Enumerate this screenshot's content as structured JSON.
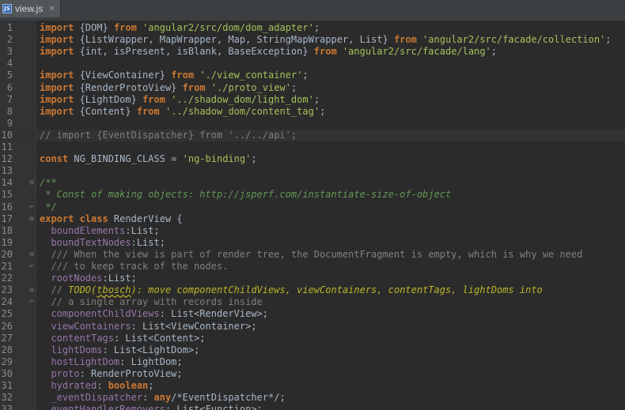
{
  "tab": {
    "label": "view.js",
    "icon": "js-file-icon",
    "icon_text": "JS"
  },
  "colors": {
    "background": "#2b2b2b",
    "keyword": "#cc7832",
    "string": "#a5c25c",
    "comment": "#808080",
    "doc_comment": "#629755",
    "property": "#9876aa",
    "todo": "#bbb529"
  },
  "lines": [
    {
      "n": "1",
      "tokens": [
        [
          "kw",
          "import"
        ],
        [
          "id",
          " {DOM} "
        ],
        [
          "kw",
          "from"
        ],
        [
          "id",
          " "
        ],
        [
          "str",
          "'angular2/src/dom/dom_adapter'"
        ],
        [
          "id",
          ";"
        ]
      ]
    },
    {
      "n": "2",
      "tokens": [
        [
          "kw",
          "import"
        ],
        [
          "id",
          " {ListWrapper, MapWrapper, Map, StringMapWrapper, List} "
        ],
        [
          "kw",
          "from"
        ],
        [
          "id",
          " "
        ],
        [
          "str",
          "'angular2/src/facade/collection'"
        ],
        [
          "id",
          ";"
        ]
      ]
    },
    {
      "n": "3",
      "tokens": [
        [
          "kw",
          "import"
        ],
        [
          "id",
          " {int, isPresent, isBlank, BaseException} "
        ],
        [
          "kw",
          "from"
        ],
        [
          "id",
          " "
        ],
        [
          "str",
          "'angular2/src/facade/lang'"
        ],
        [
          "id",
          ";"
        ]
      ]
    },
    {
      "n": "4",
      "tokens": []
    },
    {
      "n": "5",
      "tokens": [
        [
          "kw",
          "import"
        ],
        [
          "id",
          " {ViewContainer} "
        ],
        [
          "kw",
          "from"
        ],
        [
          "id",
          " "
        ],
        [
          "str",
          "'./view_container'"
        ],
        [
          "id",
          ";"
        ]
      ]
    },
    {
      "n": "6",
      "tokens": [
        [
          "kw",
          "import"
        ],
        [
          "id",
          " {RenderProtoView} "
        ],
        [
          "kw",
          "from"
        ],
        [
          "id",
          " "
        ],
        [
          "str",
          "'./proto_view'"
        ],
        [
          "id",
          ";"
        ]
      ]
    },
    {
      "n": "7",
      "tokens": [
        [
          "kw",
          "import"
        ],
        [
          "id",
          " {LightDom} "
        ],
        [
          "kw",
          "from"
        ],
        [
          "id",
          " "
        ],
        [
          "str",
          "'../shadow_dom/light_dom'"
        ],
        [
          "id",
          ";"
        ]
      ]
    },
    {
      "n": "8",
      "tokens": [
        [
          "kw",
          "import"
        ],
        [
          "id",
          " {Content} "
        ],
        [
          "kw",
          "from"
        ],
        [
          "id",
          " "
        ],
        [
          "str",
          "'../shadow_dom/content_tag'"
        ],
        [
          "id",
          ";"
        ]
      ]
    },
    {
      "n": "9",
      "tokens": []
    },
    {
      "n": "10",
      "highlight": true,
      "tokens": [
        [
          "com",
          "// import {EventDispatcher} from '../../api';"
        ]
      ]
    },
    {
      "n": "11",
      "tokens": []
    },
    {
      "n": "12",
      "tokens": [
        [
          "kw",
          "const"
        ],
        [
          "id",
          " NG_BINDING_CLASS = "
        ],
        [
          "str",
          "'ng-binding'"
        ],
        [
          "id",
          ";"
        ]
      ]
    },
    {
      "n": "13",
      "tokens": []
    },
    {
      "n": "14",
      "fold": "open",
      "tokens": [
        [
          "doc",
          "/**"
        ]
      ]
    },
    {
      "n": "15",
      "tokens": [
        [
          "doc",
          " * Const of making objects: http://jsperf.com/instantiate-size-of-object"
        ]
      ]
    },
    {
      "n": "16",
      "fold": "close",
      "tokens": [
        [
          "doc",
          " */"
        ]
      ]
    },
    {
      "n": "17",
      "fold": "open",
      "tokens": [
        [
          "kw",
          "export class"
        ],
        [
          "id",
          " RenderView {"
        ]
      ]
    },
    {
      "n": "18",
      "tokens": [
        [
          "id",
          "  "
        ],
        [
          "prop",
          "boundElements"
        ],
        [
          "id",
          ":List;"
        ]
      ]
    },
    {
      "n": "19",
      "tokens": [
        [
          "id",
          "  "
        ],
        [
          "prop",
          "boundTextNodes"
        ],
        [
          "id",
          ":List;"
        ]
      ]
    },
    {
      "n": "20",
      "fold": "open",
      "tokens": [
        [
          "com",
          "  /// When the view is part of render tree, the DocumentFragment is empty, which is why we need"
        ]
      ]
    },
    {
      "n": "21",
      "fold": "close",
      "tokens": [
        [
          "com",
          "  /// to keep track of the nodes."
        ]
      ]
    },
    {
      "n": "22",
      "tokens": [
        [
          "id",
          "  "
        ],
        [
          "prop",
          "rootNodes"
        ],
        [
          "id",
          ":List;"
        ]
      ]
    },
    {
      "n": "23",
      "fold": "open",
      "tokens": [
        [
          "com",
          "  // "
        ],
        [
          "todo",
          "TODO("
        ],
        [
          "ul",
          "tbosch"
        ],
        [
          "todo",
          "): move componentChildViews, viewContainers, contentTags, lightDoms into"
        ]
      ]
    },
    {
      "n": "24",
      "fold": "close",
      "tokens": [
        [
          "com",
          "  // a single array with records inside"
        ]
      ]
    },
    {
      "n": "25",
      "tokens": [
        [
          "id",
          "  "
        ],
        [
          "prop",
          "componentChildViews"
        ],
        [
          "id",
          ": List<RenderView>;"
        ]
      ]
    },
    {
      "n": "26",
      "tokens": [
        [
          "id",
          "  "
        ],
        [
          "prop",
          "viewContainers"
        ],
        [
          "id",
          ": List<ViewContainer>;"
        ]
      ]
    },
    {
      "n": "27",
      "tokens": [
        [
          "id",
          "  "
        ],
        [
          "prop",
          "contentTags"
        ],
        [
          "id",
          ": List<Content>;"
        ]
      ]
    },
    {
      "n": "28",
      "tokens": [
        [
          "id",
          "  "
        ],
        [
          "prop",
          "lightDoms"
        ],
        [
          "id",
          ": List<LightDom>;"
        ]
      ]
    },
    {
      "n": "29",
      "tokens": [
        [
          "id",
          "  "
        ],
        [
          "prop",
          "hostLightDom"
        ],
        [
          "id",
          ": LightDom;"
        ]
      ]
    },
    {
      "n": "30",
      "tokens": [
        [
          "id",
          "  "
        ],
        [
          "prop",
          "proto"
        ],
        [
          "id",
          ": RenderProtoView;"
        ]
      ]
    },
    {
      "n": "31",
      "tokens": [
        [
          "id",
          "  "
        ],
        [
          "prop",
          "hydrated"
        ],
        [
          "id",
          ": "
        ],
        [
          "kw",
          "boolean"
        ],
        [
          "id",
          ";"
        ]
      ]
    },
    {
      "n": "32",
      "tokens": [
        [
          "id",
          "  "
        ],
        [
          "prop",
          "_eventDispatcher"
        ],
        [
          "id",
          ": "
        ],
        [
          "kw",
          "any"
        ],
        [
          "id",
          "/*EventDispatcher*/;"
        ]
      ]
    },
    {
      "n": "33",
      "tokens": [
        [
          "id",
          "  "
        ],
        [
          "prop",
          "eventHandlerRemovers"
        ],
        [
          "id",
          ": List<Function>;"
        ]
      ]
    }
  ]
}
